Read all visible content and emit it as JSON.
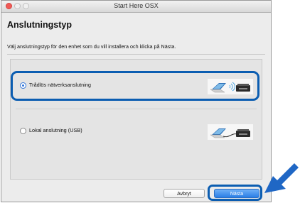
{
  "window": {
    "title": "Start Here OSX"
  },
  "page": {
    "heading": "Anslutningstyp",
    "instruction": "Välj anslutningstyp för den enhet som du vill installera och klicka på Nästa."
  },
  "options": [
    {
      "label": "Trådlös nätverksanslutning",
      "selected": true,
      "icon": "laptop-wifi-printer-icon"
    },
    {
      "label": "Lokal anslutning (USB)",
      "selected": false,
      "icon": "laptop-usb-printer-icon"
    }
  ],
  "buttons": {
    "cancel": "Avbryt",
    "next": "Nästa"
  },
  "colors": {
    "highlight": "#0b5db1",
    "accent": "#2f73d8",
    "window_background": "#ececec"
  }
}
